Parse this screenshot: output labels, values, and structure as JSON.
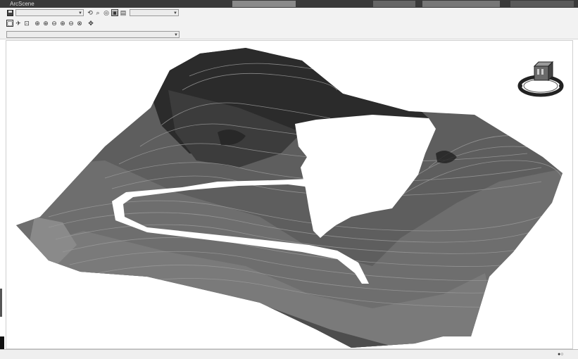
{
  "window": {
    "title": "ArcScene"
  },
  "toolbar": {
    "layer_select": "",
    "target_select": "",
    "layer_combo": ""
  },
  "icons": {
    "save": "save-icon",
    "navigate": "navigate-icon",
    "zoom_in": "zoom-in-icon",
    "zoom_out": "zoom-out-icon",
    "pan": "pan-icon",
    "full_extent": "full-extent-icon",
    "identify": "identify-icon",
    "navigation_widget": "navigation-compass-icon"
  },
  "status": {
    "coord_readout": "",
    "scale_readout": ""
  },
  "colors": {
    "terrain_dark": "#2b2b2b",
    "terrain_mid": "#5e5e5e",
    "terrain_light": "#8a8a8a",
    "contour": "#9a9a9a"
  }
}
